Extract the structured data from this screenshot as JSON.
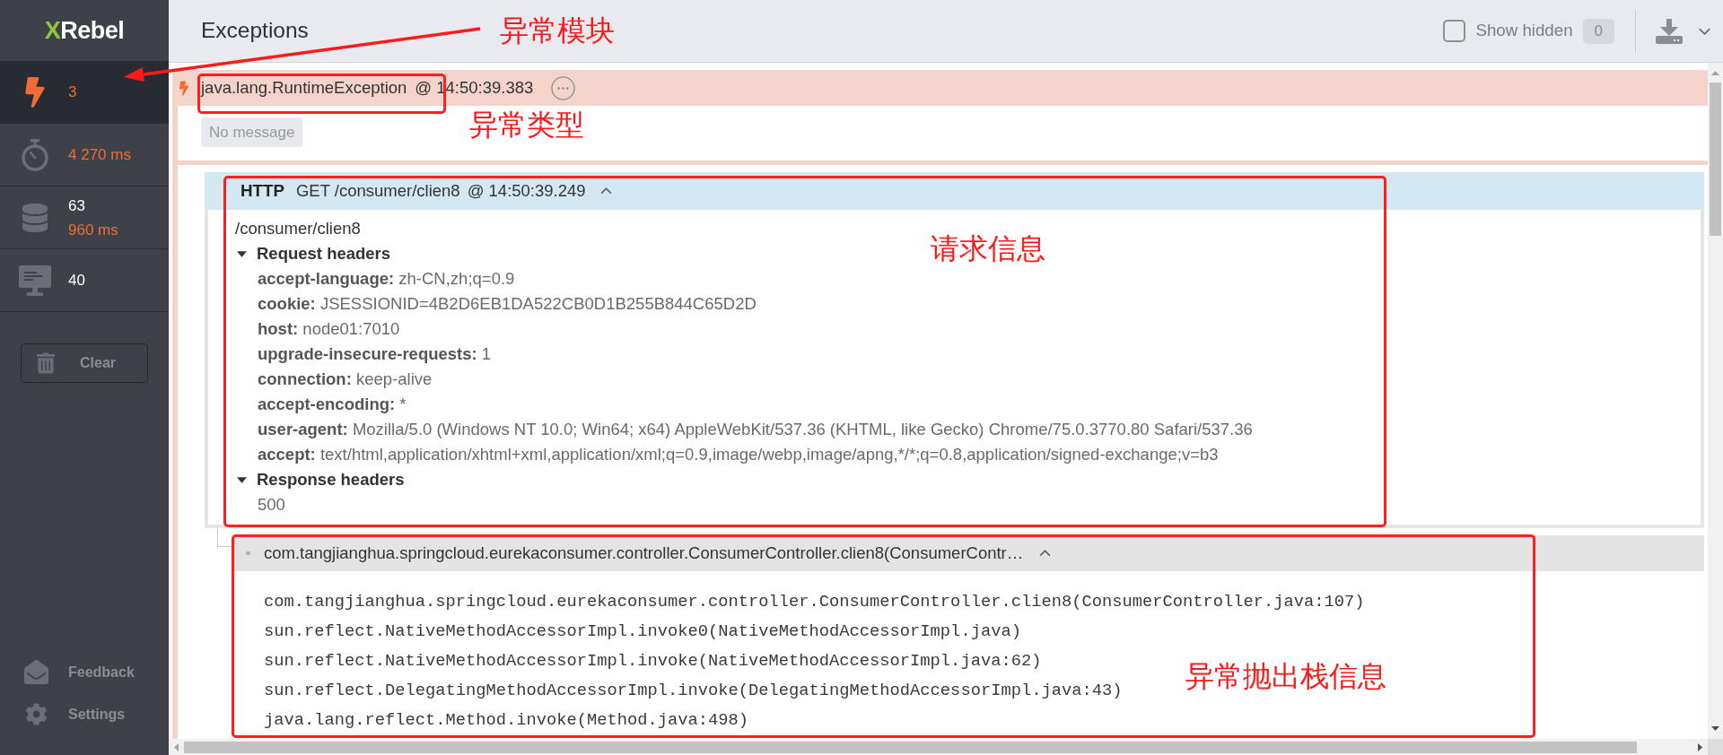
{
  "sidebar": {
    "logo": {
      "accent": "X",
      "rest": "Rebel"
    },
    "items": [
      {
        "kind": "exceptions",
        "selected": true,
        "values": [
          {
            "text": "3",
            "alert": true
          }
        ]
      },
      {
        "kind": "timer",
        "selected": false,
        "values": [
          {
            "text": "4 270 ms",
            "alert": true
          }
        ]
      },
      {
        "kind": "database",
        "selected": false,
        "values": [
          {
            "text": "63",
            "alert": false
          },
          {
            "text": "960 ms",
            "alert": true
          }
        ]
      },
      {
        "kind": "monitor",
        "selected": false,
        "values": [
          {
            "text": "40",
            "alert": false
          }
        ]
      }
    ],
    "clear_button": "Clear",
    "footer": [
      {
        "kind": "feedback",
        "label": "Feedback"
      },
      {
        "kind": "settings",
        "label": "Settings"
      }
    ]
  },
  "header": {
    "title": "Exceptions",
    "show_hidden": {
      "label": "Show hidden",
      "checked": false,
      "count": "0"
    }
  },
  "exception": {
    "type": "java.lang.RuntimeException",
    "time": "@ 14:50:39.383",
    "message": "No message",
    "http": {
      "label": "HTTP",
      "request": "GET /consumer/clien8",
      "time": "@ 14:50:39.249",
      "expanded": true,
      "path": "/consumer/clien8",
      "sections": [
        {
          "title": "Request headers",
          "expanded": true,
          "rows": [
            {
              "name": "accept-language:",
              "value": "zh-CN,zh;q=0.9"
            },
            {
              "name": "cookie:",
              "value": "JSESSIONID=4B2D6EB1DA522CB0D1B255B844C65D2D"
            },
            {
              "name": "host:",
              "value": "node01:7010"
            },
            {
              "name": "upgrade-insecure-requests:",
              "value": "1"
            },
            {
              "name": "connection:",
              "value": "keep-alive"
            },
            {
              "name": "accept-encoding:",
              "value": "*"
            },
            {
              "name": "user-agent:",
              "value": "Mozilla/5.0 (Windows NT 10.0; Win64; x64) AppleWebKit/537.36 (KHTML, like Gecko) Chrome/75.0.3770.80 Safari/537.36"
            },
            {
              "name": "accept:",
              "value": "text/html,application/xhtml+xml,application/xml;q=0.9,image/webp,image/apng,*/*;q=0.8,application/signed-exchange;v=b3"
            }
          ]
        },
        {
          "title": "Response headers",
          "expanded": true,
          "rows": [
            {
              "value": "500"
            }
          ]
        }
      ]
    },
    "stack": {
      "title": "com.tangjianghua.springcloud.eurekaconsumer.controller.ConsumerController.clien8(ConsumerContr…",
      "expanded": true,
      "frames": [
        "com.tangjianghua.springcloud.eurekaconsumer.controller.ConsumerController.clien8(ConsumerController.java:107)",
        "sun.reflect.NativeMethodAccessorImpl.invoke0(NativeMethodAccessorImpl.java)",
        "sun.reflect.NativeMethodAccessorImpl.invoke(NativeMethodAccessorImpl.java:62)",
        "sun.reflect.DelegatingMethodAccessorImpl.invoke(DelegatingMethodAccessorImpl.java:43)",
        "java.lang.reflect.Method.invoke(Method.java:498)"
      ]
    }
  },
  "annotations": [
    {
      "kind": "arrow",
      "text": "异常模块"
    },
    {
      "kind": "frame",
      "text": "异常类型"
    },
    {
      "kind": "frame",
      "text": "请求信息"
    },
    {
      "kind": "frame",
      "text": "异常抛出栈信息"
    }
  ]
}
